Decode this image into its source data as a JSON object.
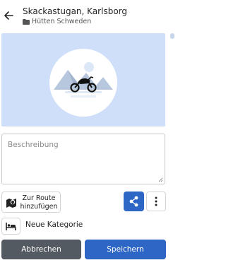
{
  "header": {
    "title": "Skackastugan, Karlsborg",
    "subtitle": "Hütten Schweden",
    "back_icon": "arrow-left-icon",
    "folder_icon": "folder-icon"
  },
  "image": {
    "placeholder_icon": "motorcycle-mountain-icon"
  },
  "description": {
    "value": "",
    "placeholder": "Beschreibung"
  },
  "actions": {
    "route_label_line1": "Zur Route",
    "route_label_line2": "hinzufügen",
    "route_icon": "map-pin-icon",
    "share_icon": "share-icon",
    "more_icon": "more-vertical-icon"
  },
  "category": {
    "label": "Neue Kategorie",
    "icon": "bed-icon"
  },
  "footer": {
    "cancel_label": "Abbrechen",
    "save_label": "Speichern"
  },
  "colors": {
    "primary": "#2e66c6",
    "secondary": "#535a61",
    "image_bg": "#cfdff9"
  }
}
